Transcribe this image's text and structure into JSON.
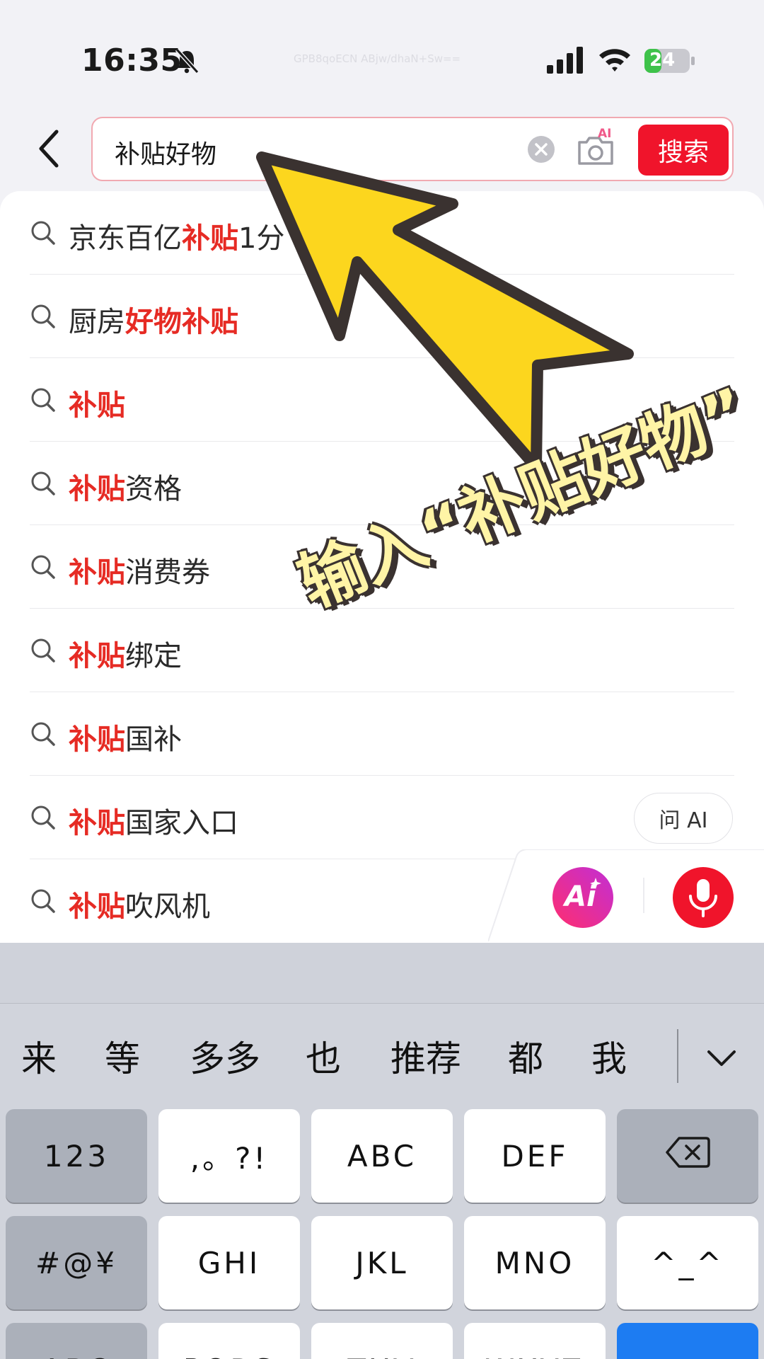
{
  "status_bar": {
    "time": "16:35",
    "battery": "24",
    "watermark": "GPB8qoECN ABjw/dhaN+Sw=="
  },
  "search": {
    "query": "补贴好物",
    "button_label": "搜索",
    "camera_badge": "AI"
  },
  "suggestions": [
    {
      "parts": [
        {
          "t": "京东百亿",
          "hl": false
        },
        {
          "t": "补贴",
          "hl": true
        },
        {
          "t": "1分",
          "hl": false
        }
      ]
    },
    {
      "parts": [
        {
          "t": "厨房",
          "hl": false
        },
        {
          "t": "好物补贴",
          "hl": true
        }
      ]
    },
    {
      "parts": [
        {
          "t": "补贴",
          "hl": true
        }
      ]
    },
    {
      "parts": [
        {
          "t": "补贴",
          "hl": true
        },
        {
          "t": "资格",
          "hl": false
        }
      ]
    },
    {
      "parts": [
        {
          "t": "补贴",
          "hl": true
        },
        {
          "t": "消费券",
          "hl": false
        }
      ]
    },
    {
      "parts": [
        {
          "t": "补贴",
          "hl": true
        },
        {
          "t": "绑定",
          "hl": false
        }
      ]
    },
    {
      "parts": [
        {
          "t": "补贴",
          "hl": true
        },
        {
          "t": "国补",
          "hl": false
        }
      ]
    },
    {
      "parts": [
        {
          "t": "补贴",
          "hl": true
        },
        {
          "t": "国家入口",
          "hl": false
        }
      ]
    },
    {
      "parts": [
        {
          "t": "补贴",
          "hl": true
        },
        {
          "t": "吹风机",
          "hl": false
        }
      ]
    }
  ],
  "ask_ai_label": "问 AI",
  "ai_button_label": "Ai",
  "overlay_caption": "输入“补贴好物”",
  "colors": {
    "accent": "#f0142b",
    "highlight": "#e62b24",
    "arrow_fill": "#fcd61e",
    "arrow_stroke": "#3a3230"
  },
  "keyboard": {
    "candidates": [
      "来",
      "等",
      "多多",
      "也",
      "推荐",
      "都",
      "我"
    ],
    "rows": [
      [
        {
          "label": "123",
          "style": "dark"
        },
        {
          "label": ",。?!",
          "style": "light"
        },
        {
          "label": "ABC",
          "style": "light"
        },
        {
          "label": "DEF",
          "style": "light"
        },
        {
          "label": "",
          "icon": "backspace-icon",
          "style": "dark"
        }
      ],
      [
        {
          "label": "#@¥",
          "style": "dark"
        },
        {
          "label": "GHI",
          "style": "light"
        },
        {
          "label": "JKL",
          "style": "light"
        },
        {
          "label": "MNO",
          "style": "light"
        },
        {
          "label": "^_^",
          "style": "light"
        }
      ],
      [
        {
          "label": "ABC",
          "style": "dark"
        },
        {
          "label": "PQRS",
          "style": "light"
        },
        {
          "label": "TUV",
          "style": "light"
        },
        {
          "label": "WXYZ",
          "style": "light"
        },
        {
          "label": "",
          "style": "blue"
        }
      ]
    ]
  }
}
